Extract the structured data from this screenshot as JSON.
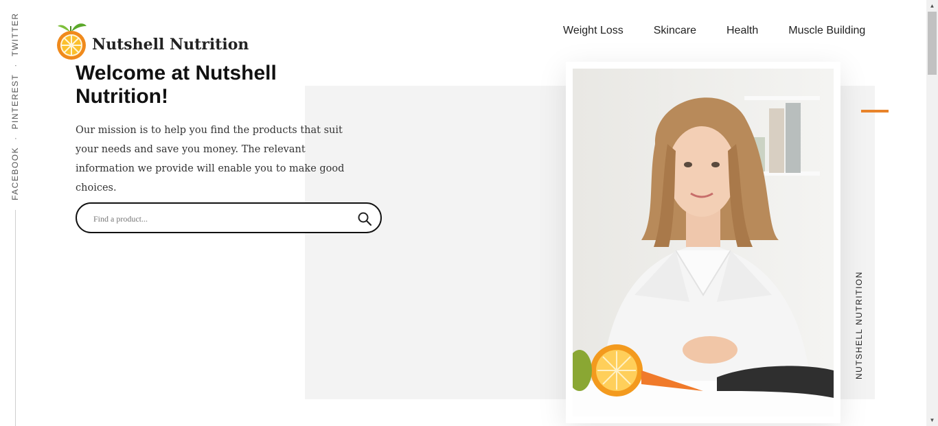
{
  "social": {
    "facebook": "FACEBOOK",
    "pinterest": "PINTEREST",
    "twitter": "TWITTER",
    "separator": "·"
  },
  "brand": {
    "name": "Nutshell Nutrition",
    "vertical_caption": "NUTSHELL NUTRITION"
  },
  "nav": {
    "items": [
      "Weight Loss",
      "Skincare",
      "Health",
      "Muscle Building"
    ]
  },
  "hero": {
    "title": "Welcome at Nutshell Nutrition!",
    "description": "Our mission is to help you find the products that suit your needs and save you money. The relevant information we provide will enable you to make good choices."
  },
  "search": {
    "placeholder": "Find a product...",
    "value": ""
  },
  "colors": {
    "accent": "#e8832a",
    "panel": "#f3f3f3"
  },
  "icons": {
    "search": "search-icon",
    "logo": "orange-logo-icon"
  }
}
